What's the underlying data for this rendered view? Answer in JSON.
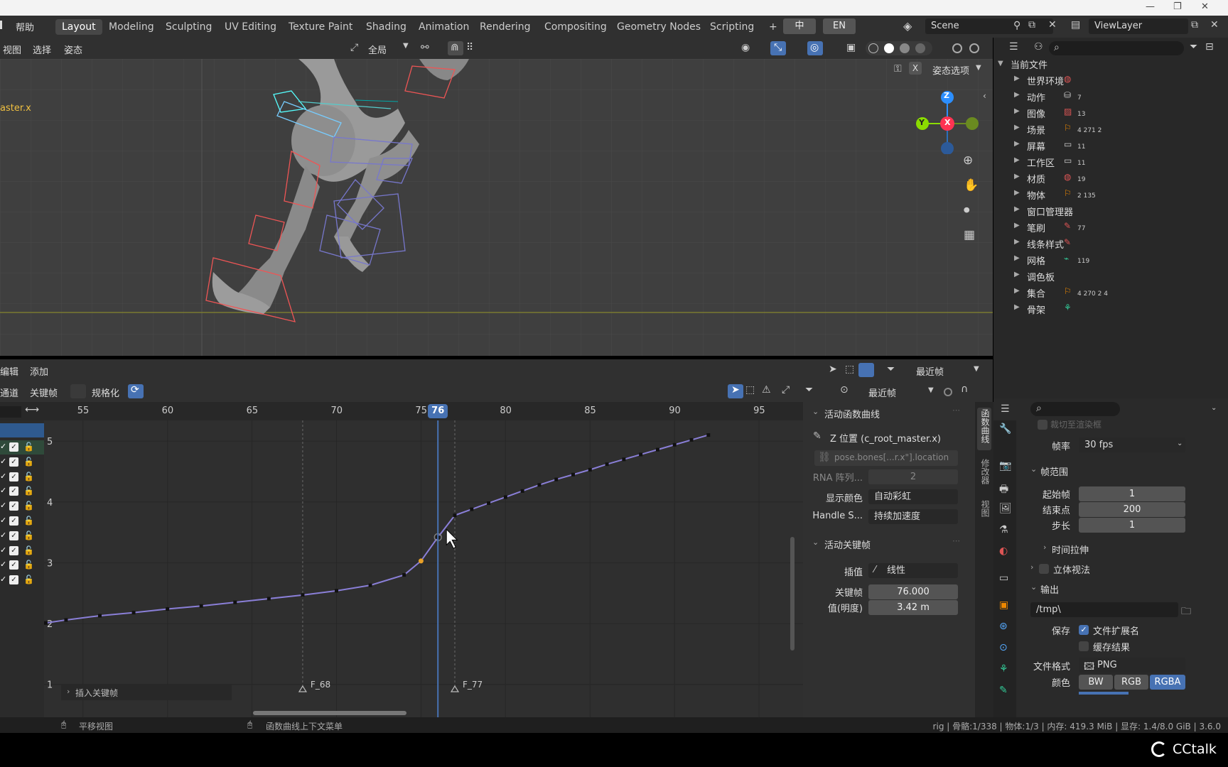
{
  "topbar": {
    "help_menu": "帮助",
    "workspaces": [
      "Layout",
      "Modeling",
      "Sculpting",
      "UV Editing",
      "Texture Paint",
      "Shading",
      "Animation",
      "Rendering",
      "Compositing",
      "Geometry Nodes",
      "Scripting"
    ],
    "add_tab": "+",
    "lang_zh": "中",
    "lang_en": "EN",
    "scene": "Scene",
    "view_layer": "ViewLayer"
  },
  "viewport": {
    "menus": [
      "视图",
      "选择",
      "姿态"
    ],
    "transform_orientation": "全局",
    "object_label": "aster.x",
    "pose_options": "姿态选项",
    "close_x": "X",
    "gizmo": {
      "z": "Z",
      "x": "X",
      "y": "Y"
    }
  },
  "graph_editor": {
    "header1_menus": [
      "编辑",
      "添加"
    ],
    "header1_pivot": "最近帧",
    "header2_menus": [
      "通道",
      "关键帧"
    ],
    "normalize": "规格化",
    "header2_pivot": "最近帧",
    "current_frame": "76",
    "frame_ticks": [
      "55",
      "60",
      "65",
      "70",
      "75",
      "80",
      "85",
      "90",
      "95"
    ],
    "value_ticks": [
      "5",
      "4",
      "3",
      "2",
      "1"
    ],
    "markers": [
      "F_68",
      "F_77"
    ],
    "insert_keyframe": "插入关键帧",
    "channel_rows": 10
  },
  "chart_data": {
    "type": "line",
    "xlabel": "",
    "ylabel": "",
    "xlim": [
      52.7,
      97.6
    ],
    "ylim": [
      0.6,
      5.2
    ],
    "series": [
      {
        "x": [
          52.8,
          54,
          56,
          58,
          60,
          62,
          64,
          66,
          68,
          70,
          72,
          74,
          75,
          76,
          77,
          78,
          79,
          80,
          81,
          82,
          83,
          84,
          85,
          86,
          87,
          88,
          89,
          90,
          91,
          92
        ],
        "y": [
          2.01,
          2.06,
          2.13,
          2.18,
          2.24,
          2.29,
          2.35,
          2.41,
          2.47,
          2.54,
          2.63,
          2.8,
          3.03,
          3.42,
          3.78,
          3.88,
          3.98,
          4.08,
          4.18,
          4.28,
          4.37,
          4.45,
          4.53,
          4.62,
          4.7,
          4.78,
          4.86,
          4.94,
          5.02,
          5.1
        ]
      }
    ],
    "active_key": {
      "frame": 75.0,
      "value": 3.03
    },
    "selected_key": {
      "frame": 76.0,
      "value": 3.42
    }
  },
  "npanel": {
    "fcurve_section": "活动函数曲线",
    "fcurve_name": "Z 位置 (c_root_master.x)",
    "data_path": "pose.bones[...r.x\"].location",
    "rna_label": "RNA 阵列...",
    "rna_value": "2",
    "color_label": "显示颜色",
    "color_value": "自动彩虹",
    "handle_label": "Handle S...",
    "handle_value": "持续加速度",
    "keyframe_section": "活动关键帧",
    "interp_label": "插值",
    "interp_value": "线性",
    "frame_label": "关键帧",
    "frame_value": "76.000",
    "value_label": "值(明度)",
    "value_value": "3.42 m",
    "tabs": [
      "函数曲线",
      "修改器",
      "视图"
    ]
  },
  "outliner": {
    "root": "当前文件",
    "items": [
      {
        "label": "世界环境",
        "badge": ""
      },
      {
        "label": "动作",
        "badge": "7"
      },
      {
        "label": "图像",
        "badge": "13"
      },
      {
        "label": "场景",
        "badge": "4 271 2"
      },
      {
        "label": "屏幕",
        "badge": "11"
      },
      {
        "label": "工作区",
        "badge": "11"
      },
      {
        "label": "材质",
        "badge": "19"
      },
      {
        "label": "物体",
        "badge": "2 135"
      },
      {
        "label": "窗口管理器",
        "badge": ""
      },
      {
        "label": "笔刷",
        "badge": "77"
      },
      {
        "label": "线条样式",
        "badge": ""
      },
      {
        "label": "网格",
        "badge": "119"
      },
      {
        "label": "调色板",
        "badge": ""
      },
      {
        "label": "集合",
        "badge": "4 270 2 4"
      },
      {
        "label": "骨架",
        "badge": ""
      }
    ]
  },
  "properties": {
    "crop_label": "裁切至渲染框",
    "fps_label": "帧率",
    "fps_value": "30 fps",
    "frame_range": "帧范围",
    "start_label": "起始帧",
    "start_value": "1",
    "end_label": "结束点",
    "end_value": "200",
    "step_label": "步长",
    "step_value": "1",
    "time_stretch": "时间拉伸",
    "stereoscopy": "立体视法",
    "output": "输出",
    "output_path": "/tmp\\",
    "save_label": "保存",
    "file_ext": "文件扩展名",
    "cache_result": "缓存结果",
    "format_label": "文件格式",
    "format_value": "PNG",
    "color_label": "颜色",
    "color_bw": "BW",
    "color_rgb": "RGB",
    "color_rgba": "RGBA"
  },
  "status": {
    "pan": "平移视图",
    "context_menu": "函数曲线上下文菜单",
    "info": "rig | 骨骼:1/338 | 物体:1/3 | 内存: 419.3 MiB | 显存: 1.4/8.0 GiB | 3.6.0"
  },
  "watermark": "CCtalk",
  "colors": {
    "accent": "#4772b3",
    "curve": "#8a7fd8",
    "active_key": "#e8a028",
    "x_axis": "#ff3352",
    "y_axis": "#8bdc00",
    "z_axis": "#2c8fff"
  }
}
